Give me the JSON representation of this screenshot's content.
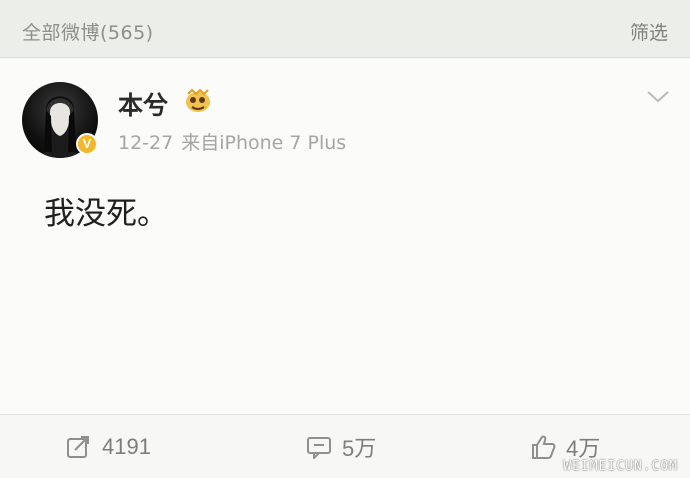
{
  "topbar": {
    "weibo_count": "全部微博(565)",
    "filter_label": "筛选"
  },
  "post": {
    "username": "本兮",
    "time": "12-27",
    "source": "来自iPhone 7 Plus",
    "text": "我没死。",
    "verified_badge": "V"
  },
  "actions": {
    "repost_count": "4191",
    "comment_count": "5万",
    "like_count": "4万"
  },
  "icons": {
    "verified": "verified-badge-icon",
    "member": "member-crown-icon",
    "menu": "chevron-down-icon",
    "repost": "repost-icon",
    "comment": "comment-icon",
    "like": "like-icon"
  },
  "colors": {
    "verified": "#f3b72b",
    "text_secondary": "#a3a6a1"
  },
  "watermark": "WEIMEICUN.COM"
}
